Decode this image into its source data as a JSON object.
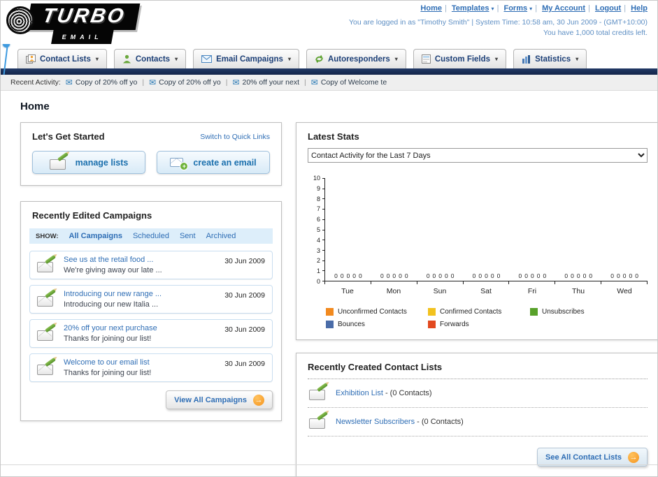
{
  "header": {
    "logo_top": "TURBO",
    "logo_bottom": "EMAIL",
    "nav": [
      {
        "label": "Home"
      },
      {
        "label": "Templates"
      },
      {
        "label": "Forms"
      },
      {
        "label": "My Account"
      },
      {
        "label": "Logout"
      },
      {
        "label": "Help"
      }
    ],
    "login_status": "You are logged in as \"Timothy Smith\" | System Time: 10:58 am, 30 Jun 2009 - (GMT+10:00)",
    "credits": "You have 1,000 total credits left."
  },
  "main_nav": [
    {
      "label": "Contact Lists"
    },
    {
      "label": "Contacts"
    },
    {
      "label": "Email Campaigns"
    },
    {
      "label": "Autoresponders"
    },
    {
      "label": "Custom Fields"
    },
    {
      "label": "Statistics"
    }
  ],
  "recent_activity": {
    "label": "Recent Activity:",
    "items": [
      "Copy of 20% off yo",
      "Copy of 20% off yo",
      "20% off your next",
      "Copy of Welcome te"
    ]
  },
  "page_title": "Home",
  "get_started": {
    "title": "Let's Get Started",
    "switch_link": "Switch to Quick Links",
    "manage_lists_label": "manage lists",
    "create_email_label": "create an email"
  },
  "campaigns": {
    "title": "Recently Edited Campaigns",
    "show_label": "SHOW:",
    "filters": [
      "All Campaigns",
      "Scheduled",
      "Sent",
      "Archived"
    ],
    "items": [
      {
        "title": "See us at the retail food ...",
        "subtitle": "We're giving away our late ...",
        "date": "30 Jun 2009"
      },
      {
        "title": "Introducing our new range ...",
        "subtitle": "Introducing our new Italia ...",
        "date": "30 Jun 2009"
      },
      {
        "title": "20% off your next purchase",
        "subtitle": "Thanks for joining our list!",
        "date": "30 Jun 2009"
      },
      {
        "title": "Welcome to our email list",
        "subtitle": "Thanks for joining our list!",
        "date": "30 Jun 2009"
      }
    ],
    "view_all_label": "View All Campaigns"
  },
  "latest_stats": {
    "title": "Latest Stats",
    "period_selected": "Contact Activity for the Last 7 Days"
  },
  "chart_data": {
    "type": "bar",
    "title": "Contact Activity for the Last 7 Days",
    "categories": [
      "Tue",
      "Mon",
      "Sun",
      "Sat",
      "Fri",
      "Thu",
      "Wed"
    ],
    "series": [
      {
        "name": "Unconfirmed Contacts",
        "color": "#f28a1f",
        "values": [
          0,
          0,
          0,
          0,
          0,
          0,
          0
        ]
      },
      {
        "name": "Confirmed Contacts",
        "color": "#f2c21f",
        "values": [
          0,
          0,
          0,
          0,
          0,
          0,
          0
        ]
      },
      {
        "name": "Unsubscribes",
        "color": "#58a12a",
        "values": [
          0,
          0,
          0,
          0,
          0,
          0,
          0
        ]
      },
      {
        "name": "Bounces",
        "color": "#4a6ca8",
        "values": [
          0,
          0,
          0,
          0,
          0,
          0,
          0
        ]
      },
      {
        "name": "Forwards",
        "color": "#e2491f",
        "values": [
          0,
          0,
          0,
          0,
          0,
          0,
          0
        ]
      }
    ],
    "ylim": [
      0,
      10
    ],
    "ytick_step": 1,
    "grid": false,
    "legend_position": "bottom"
  },
  "contact_lists": {
    "title": "Recently Created Contact Lists",
    "items": [
      {
        "name": "Exhibition List",
        "suffix": "- (0 Contacts)"
      },
      {
        "name": "Newsletter Subscribers",
        "suffix": "- (0 Contacts)"
      }
    ],
    "see_all_label": "See All Contact Lists"
  }
}
